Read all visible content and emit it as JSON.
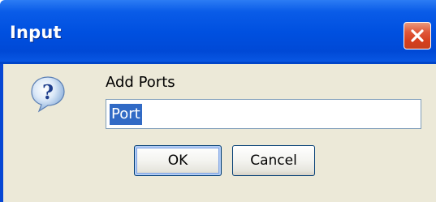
{
  "window": {
    "title": "Input"
  },
  "dialog": {
    "prompt": "Add Ports",
    "input_value": "Port",
    "ok_label": "OK",
    "cancel_label": "Cancel"
  },
  "icons": {
    "question": "question-icon",
    "close": "close-icon"
  },
  "colors": {
    "titlebar": "#0050e0",
    "close_button": "#d53f1e",
    "dialog_bg": "#ece9d8",
    "selection": "#316ac5"
  }
}
